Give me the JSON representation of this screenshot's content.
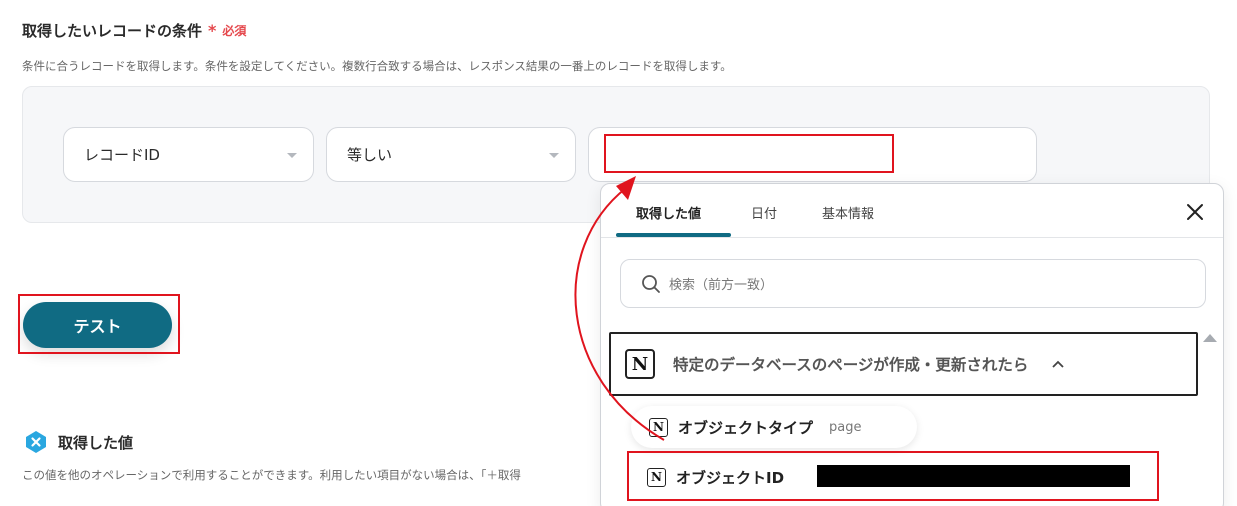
{
  "condition": {
    "title": "取得したいレコードの条件",
    "required_star": "*",
    "required_label": "必須",
    "description": "条件に合うレコードを取得します。条件を設定してください。複数行合致する場合は、レスポンス結果の一番上のレコードを取得します。",
    "field_select": "レコードID",
    "operator_select": "等しい",
    "value": ""
  },
  "test_button": {
    "label": "テスト"
  },
  "result": {
    "title": "取得した値",
    "description": "この値を他のオペレーションで利用することができます。利用したい項目がない場合は、「＋取得"
  },
  "popup": {
    "tabs": [
      "取得した値",
      "日付",
      "基本情報"
    ],
    "active_tab": "取得した値",
    "search_placeholder": "検索（前方一致）",
    "group_title": "特定のデータベースのページが作成・更新されたら",
    "items": [
      {
        "label": "オブジェクトタイプ",
        "value": "page"
      },
      {
        "label": "オブジェクトID",
        "value": ""
      }
    ],
    "notion_glyph": "N"
  },
  "colors": {
    "accent": "#106b83",
    "required": "#e5484d",
    "highlight": "#e0141e"
  },
  "icons": [
    "search-icon",
    "close-icon",
    "notion-icon",
    "chevron-up-icon",
    "chevron-down-icon",
    "x-hex-icon"
  ]
}
